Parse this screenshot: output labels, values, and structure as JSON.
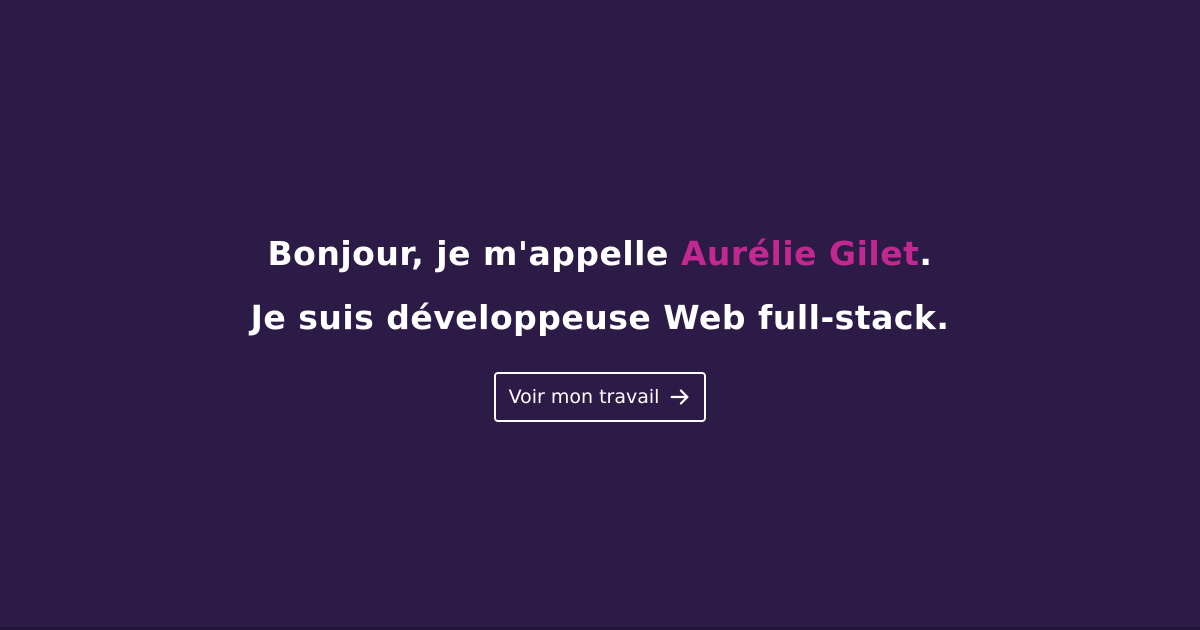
{
  "hero": {
    "line1_prefix": "Bonjour, je m'appelle ",
    "name": "Aurélie Gilet",
    "line1_suffix": ".",
    "line2": "Je suis développeuse Web full-stack."
  },
  "cta": {
    "label": "Voir mon travail",
    "icon": "arrow-right-icon"
  },
  "colors": {
    "background": "#2c1b47",
    "accent": "#c2288f",
    "text": "#ffffff"
  }
}
